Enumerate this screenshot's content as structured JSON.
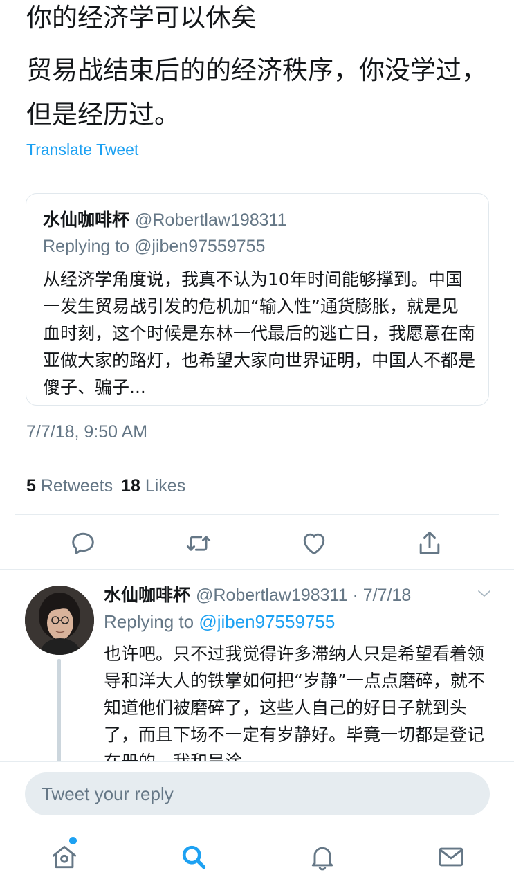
{
  "tweet": {
    "line1": "你的经济学可以休矣",
    "line2": "贸易战结束后的的经济秩序，你没学过，但是经历过。",
    "translate_label": "Translate Tweet",
    "timestamp": "7/7/18, 9:50 AM",
    "retweets_count": "5",
    "retweets_label": "Retweets",
    "likes_count": "18",
    "likes_label": "Likes"
  },
  "quoted": {
    "name": "水仙咖啡杯",
    "handle": "@Robertlaw198311",
    "replying_to": "Replying to @jiben97559755",
    "body": "从经济学角度说，我真不认为10年时间能够撑到。中国一发生贸易战引发的危机加“输入性”通货膨胀，就是见血时刻，这个时候是东林一代最后的逃亡日，我愿意在南亚做大家的路灯，也希望大家向世界证明，中国人不都是傻子、骗子..."
  },
  "reply": {
    "name": "水仙咖啡杯",
    "handle_date": "@Robertlaw198311 · 7/7/18",
    "replying_prefix": "Replying to",
    "mention": "@jiben97559755",
    "body": "也许吧。只不过我觉得许多滞纳人只是希望看着领导和洋大人的铁掌如何把“岁静”一点点磨碎，就不知道他们被磨碎了，这些人自己的好日子就到头了，而且下场不一定有岁静好。毕竟一切都是登记在册的。我和吴淦"
  },
  "reply_bar": {
    "placeholder": "Tweet your reply"
  },
  "colors": {
    "accent": "#1da1f2",
    "text_primary": "#14171a",
    "text_secondary": "#657786",
    "icon": "#657786",
    "divider": "#e6ecf0"
  },
  "icons": {
    "actions": [
      "reply-icon",
      "retweet-icon",
      "like-icon",
      "share-icon"
    ],
    "nav": [
      "home-icon",
      "search-icon",
      "notifications-icon",
      "messages-icon"
    ]
  }
}
